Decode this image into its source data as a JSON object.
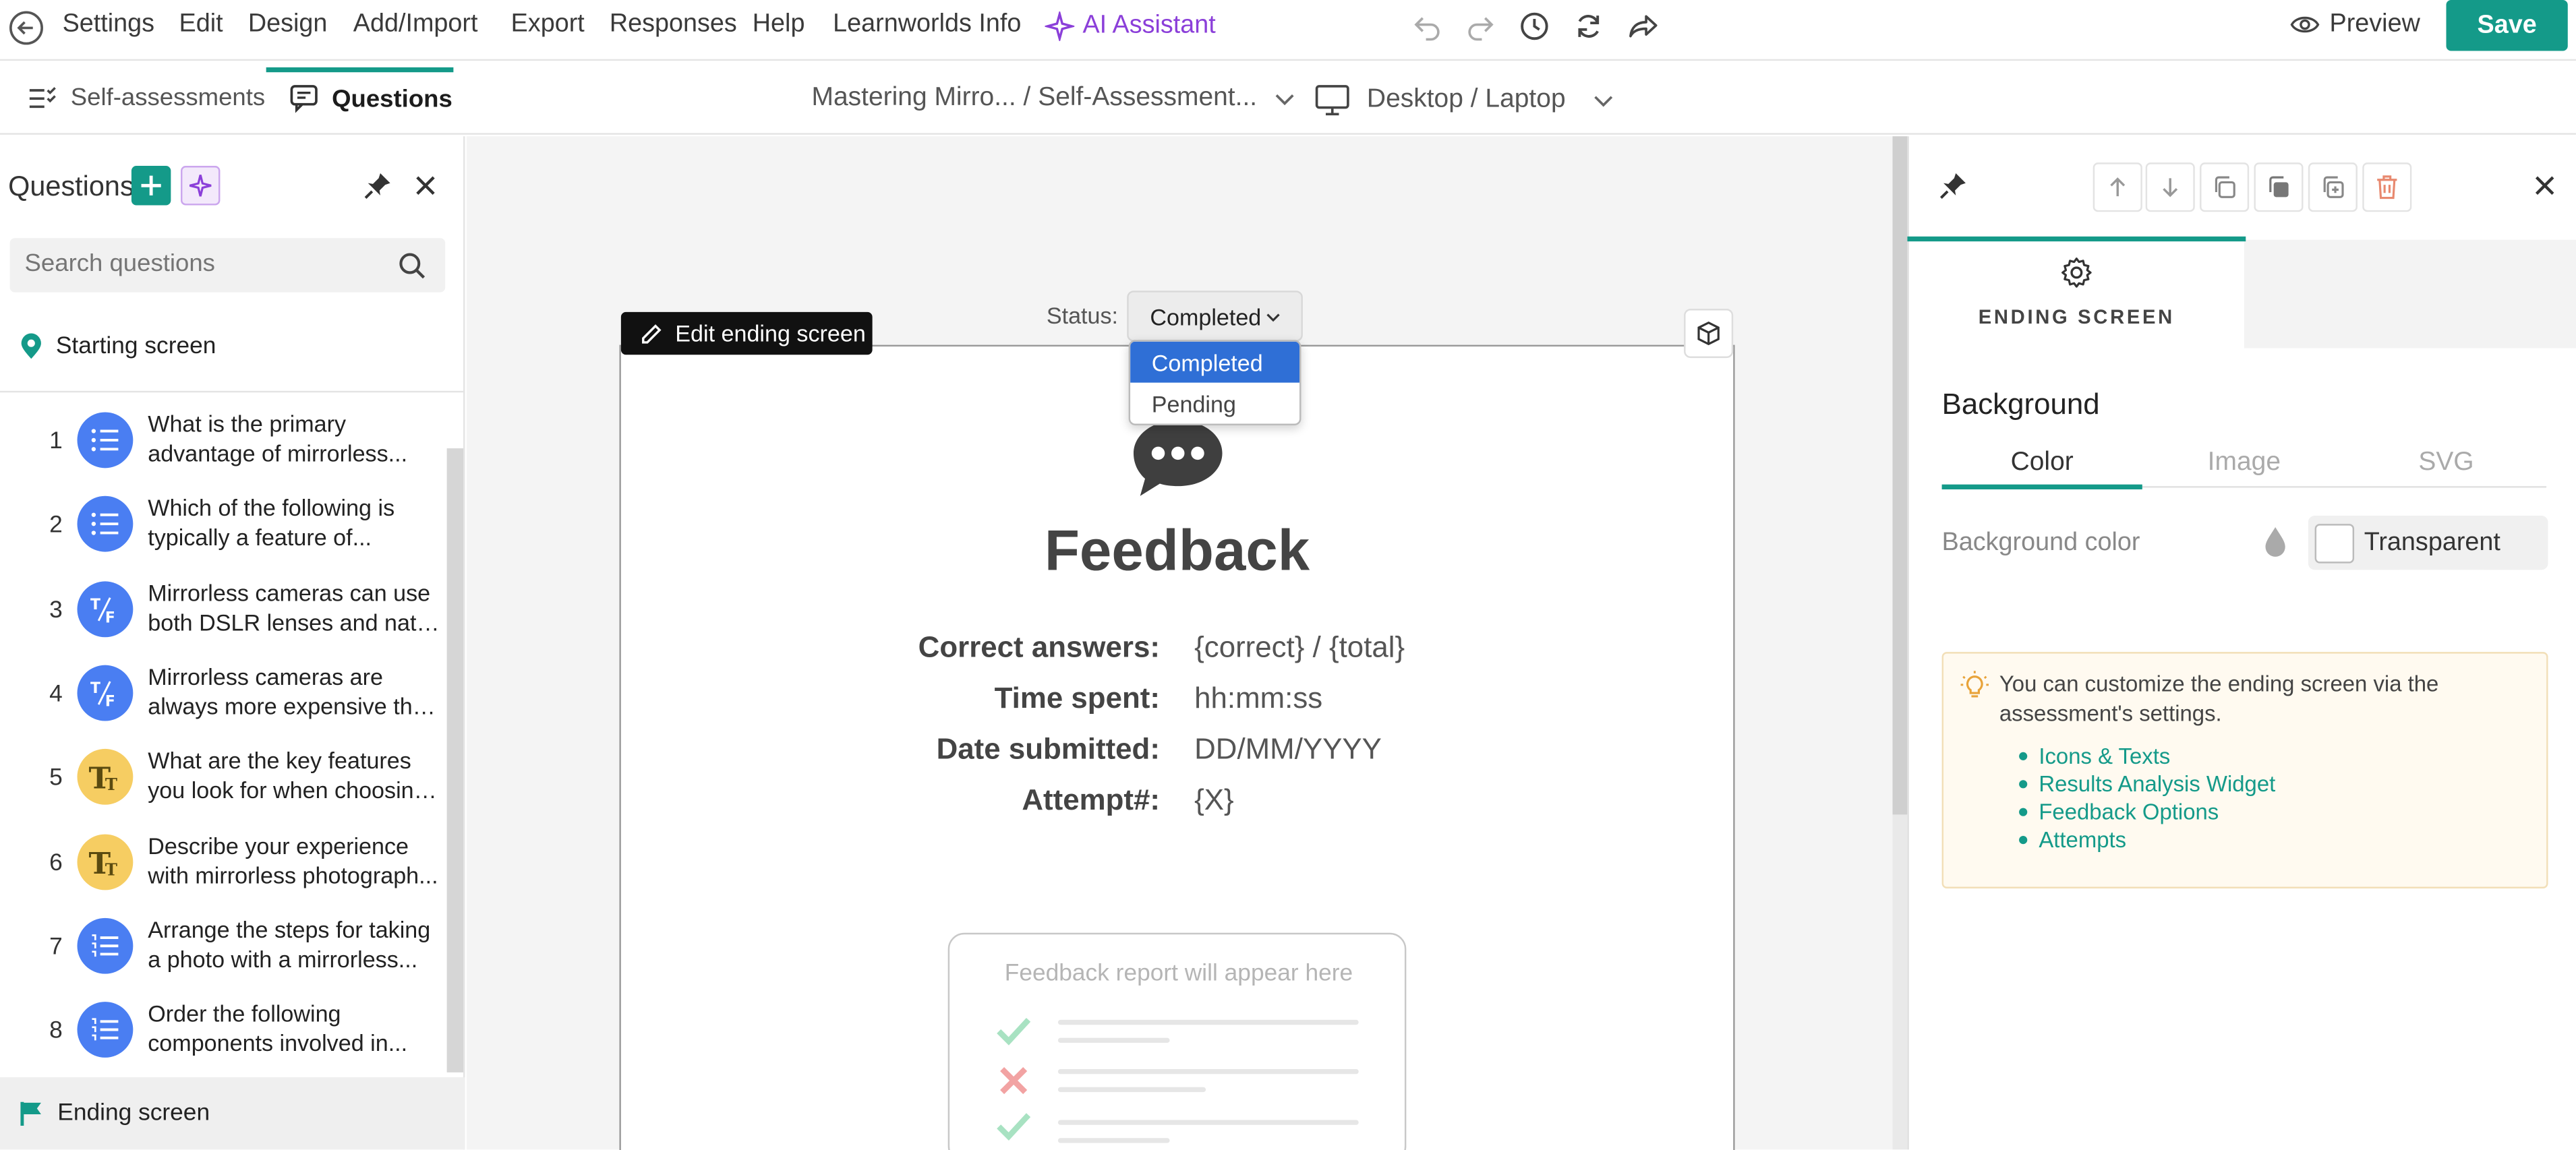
{
  "menu": {
    "items": [
      "Settings",
      "Edit",
      "Design",
      "Add/Import",
      "Export",
      "Responses",
      "Help",
      "Learnworlds Info"
    ],
    "ai_assistant": "AI Assistant",
    "preview": "Preview",
    "save": "Save"
  },
  "subbar": {
    "tab_self_assessments": "Self-assessments",
    "tab_questions": "Questions",
    "breadcrumb": "Mastering Mirro... / Self-Assessment...",
    "device": "Desktop / Laptop"
  },
  "sidebar": {
    "title": "Questions",
    "search_placeholder": "Search questions",
    "starting_screen": "Starting screen",
    "ending_screen": "Ending screen",
    "questions": [
      {
        "num": "1",
        "type": "list",
        "line1": "What is the primary",
        "line2": "advantage of mirrorless..."
      },
      {
        "num": "2",
        "type": "list",
        "line1": "Which of the following is",
        "line2": "typically a feature of..."
      },
      {
        "num": "3",
        "type": "tf",
        "line1": "Mirrorless cameras can use",
        "line2": "both DSLR lenses and nativ..."
      },
      {
        "num": "4",
        "type": "tf",
        "line1": "Mirrorless cameras are",
        "line2": "always more expensive tha..."
      },
      {
        "num": "5",
        "type": "text",
        "line1": "What are the key features",
        "line2": "you look for when choosing..."
      },
      {
        "num": "6",
        "type": "text",
        "line1": "Describe your experience",
        "line2": "with mirrorless photograph..."
      },
      {
        "num": "7",
        "type": "order",
        "line1": "Arrange the steps for taking",
        "line2": "a photo with a mirrorless..."
      },
      {
        "num": "8",
        "type": "order",
        "line1": "Order the following",
        "line2": "components involved in..."
      }
    ]
  },
  "canvas": {
    "edit_button": "Edit ending screen",
    "status_label": "Status:",
    "status_value": "Completed",
    "status_options": [
      "Completed",
      "Pending"
    ],
    "feedback_title": "Feedback",
    "rows": [
      {
        "label": "Correct answers:",
        "value": "{correct} / {total}"
      },
      {
        "label": "Time spent:",
        "value": "hh:mm:ss"
      },
      {
        "label": "Date submitted:",
        "value": "DD/MM/YYYY"
      },
      {
        "label": "Attempt#:",
        "value": "{X}"
      }
    ],
    "report_placeholder": "Feedback report will appear here"
  },
  "right_panel": {
    "tab_label": "ENDING SCREEN",
    "background_title": "Background",
    "segments": [
      "Color",
      "Image",
      "SVG"
    ],
    "bg_color_label": "Background color",
    "bg_color_value": "Transparent",
    "tip_text": "You can customize the ending screen via the assessment's settings.",
    "tip_links": [
      "Icons & Texts",
      "Results Analysis Widget",
      "Feedback Options",
      "Attempts"
    ]
  },
  "colors": {
    "accent": "#149a89",
    "ai_purple": "#8b3fd9",
    "question_blue": "#4a7ef2",
    "question_yellow": "#f6cd62",
    "dropdown_selected": "#2f6fd6",
    "delete_red": "#e8896f"
  },
  "icons": [
    "back-icon",
    "sparkle-icon",
    "undo-icon",
    "redo-icon",
    "history-icon",
    "refresh-icon",
    "share-icon",
    "eye-icon",
    "checklist-icon",
    "question-chat-icon",
    "chevron-down-icon",
    "monitor-icon",
    "plus-icon",
    "pin-icon",
    "close-icon",
    "search-icon",
    "location-pin-icon",
    "flag-icon",
    "pencil-icon",
    "cube-icon",
    "chat-bubble-icon",
    "gear-icon",
    "arrow-up-icon",
    "arrow-down-icon",
    "copy-icon",
    "duplicate-icon",
    "add-copy-icon",
    "trash-icon",
    "drop-icon",
    "lightbulb-icon"
  ]
}
